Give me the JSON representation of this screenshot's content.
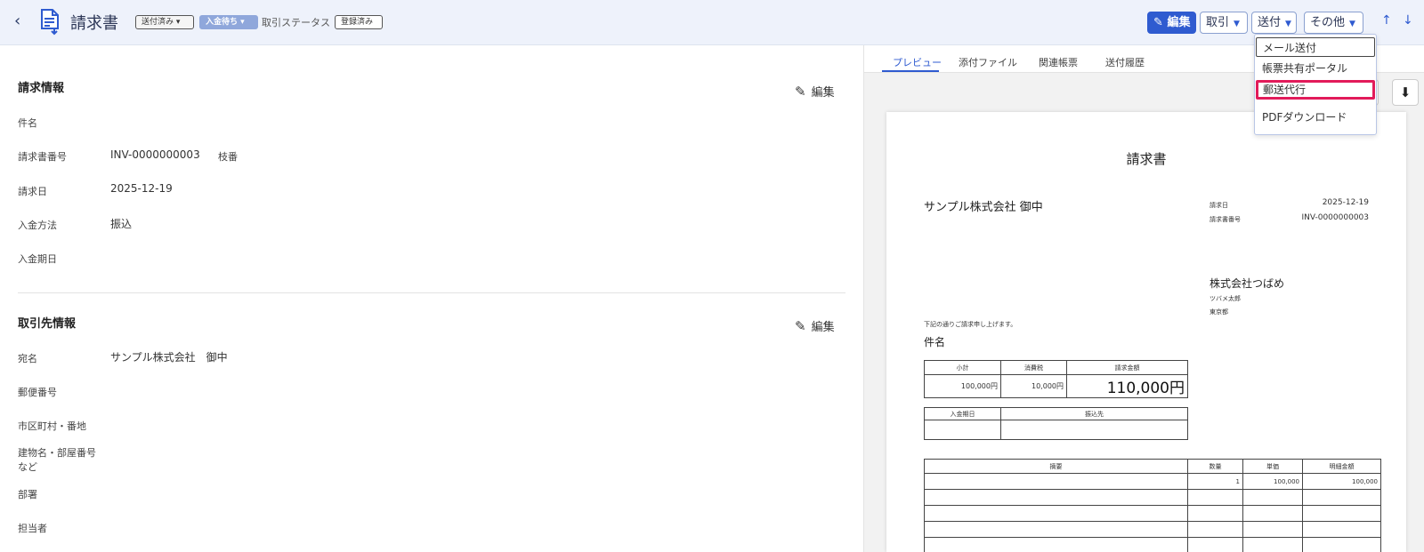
{
  "header": {
    "back_icon": "chevron-left-icon",
    "doc_icon": "invoice-document-icon",
    "title": "請求書",
    "send_status_tag": "送付済み",
    "payment_status_tag": "入金待ち",
    "trade_status_label": "取引ステータス",
    "registration_tag": "登録済み",
    "buttons": {
      "edit": "編集",
      "trade": "取引",
      "send": "送付",
      "other": "その他"
    },
    "up_arrow": "↑",
    "down_arrow": "↓"
  },
  "send_menu": {
    "items": [
      "メール送付",
      "帳票共有ポータル",
      "郵送代行",
      "PDFダウンロード"
    ]
  },
  "invoice_info": {
    "title": "請求情報",
    "edit_label": "編集",
    "fields": [
      {
        "label": "件名",
        "value": ""
      },
      {
        "label": "請求書番号",
        "value": "INV-0000000003",
        "extra": "枝番"
      },
      {
        "label": "請求日",
        "value": "2025-12-19"
      },
      {
        "label": "入金方法",
        "value": "振込"
      },
      {
        "label": "入金期日",
        "value": ""
      }
    ]
  },
  "partner_info": {
    "title": "取引先情報",
    "edit_label": "編集",
    "fields": [
      {
        "label": "宛名",
        "value": "サンプル株式会社　御中"
      },
      {
        "label": "郵便番号",
        "value": ""
      },
      {
        "label": "市区町村・番地",
        "value": ""
      },
      {
        "label": "建物名・部屋番号など",
        "value": ""
      },
      {
        "label": "部署",
        "value": ""
      },
      {
        "label": "担当者",
        "value": ""
      }
    ]
  },
  "tabs": [
    "プレビュー",
    "添付ファイル",
    "関連帳票",
    "送付履歴"
  ],
  "preview": {
    "title": "請求書",
    "to": "サンプル株式会社 御中",
    "date_label": "請求日",
    "date_value": "2025-12-19",
    "number_label": "請求書番号",
    "number_value": "INV-0000000003",
    "company": "株式会社つばめ",
    "person": "ツバメ太郎",
    "address": "東京都",
    "note": "下記の通りご請求申し上げます。",
    "subject_label": "件名",
    "summary": {
      "headers": [
        "小計",
        "消費税",
        "請求金額"
      ],
      "values": [
        "100,000円",
        "10,000円",
        "110,000円"
      ]
    },
    "payment": {
      "headers": [
        "入金期日",
        "振込先"
      ]
    },
    "items": {
      "headers": [
        "摘要",
        "数量",
        "単価",
        "明細金額"
      ],
      "rows": [
        [
          "",
          "1",
          "100,000",
          "100,000"
        ]
      ]
    }
  },
  "colors": {
    "accent": "#2f5bd0",
    "highlight": "#e21b5a",
    "header_bg": "#eef2fb"
  }
}
